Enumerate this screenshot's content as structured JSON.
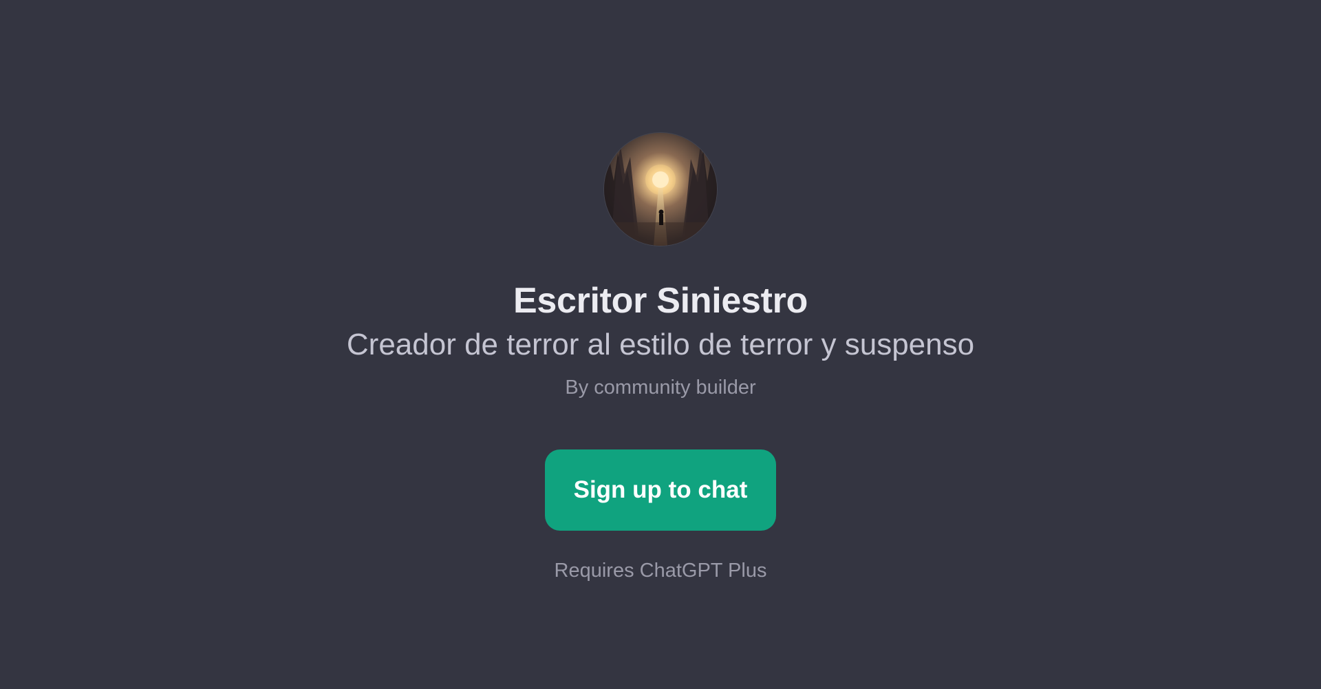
{
  "gpt": {
    "name": "Escritor Siniestro",
    "description": "Creador de terror al estilo de terror y suspenso",
    "author": "By community builder",
    "avatar_icon": "dark-gothic-city-portal-image"
  },
  "actions": {
    "signup_label": "Sign up to chat",
    "requirement": "Requires ChatGPT Plus"
  },
  "colors": {
    "background": "#343541",
    "accent": "#10a37f",
    "title": "#ececf1",
    "subtitle": "#c5c5d2",
    "muted": "#9a9aa8"
  }
}
